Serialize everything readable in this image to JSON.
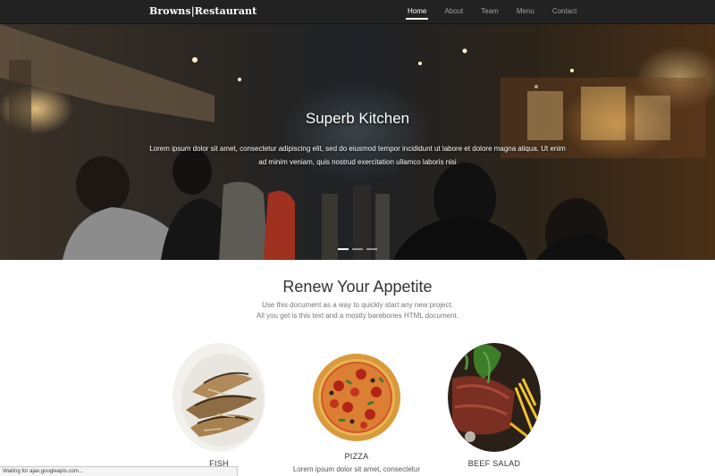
{
  "navbar": {
    "brand": "Browns|Restaurant",
    "items": [
      {
        "label": "Home",
        "active": true
      },
      {
        "label": "About",
        "active": false
      },
      {
        "label": "Team",
        "active": false
      },
      {
        "label": "Menu",
        "active": false
      },
      {
        "label": "Contact",
        "active": false
      }
    ]
  },
  "hero": {
    "title": "Superb Kitchen",
    "text": "Lorem ipsum dolor sit amet, consectetur adipiscing elit, sed do eiusmod tempor incididunt ut labore et dolore magna aliqua. Ut enim ad minim veniam, quis nostrud exercitation ullamco laboris nisi",
    "slides": 3,
    "active_slide": 0
  },
  "intro": {
    "title": "Renew Your Appetite",
    "line1": "Use this document as a way to quickly start any new project.",
    "line2": "All you get is this text and a mostly barebones HTML document."
  },
  "dishes": [
    {
      "name": "FISH",
      "description": "",
      "icon": "fried-fish-plate"
    },
    {
      "name": "PIZZA",
      "description": "Lorem ipsum dolor sit amet, consectetur",
      "icon": "pizza"
    },
    {
      "name": "BEEF SALAD",
      "description": "",
      "icon": "beef-salad"
    }
  ],
  "status_bar": {
    "text": "Waiting for ajax.googleapis.com..."
  },
  "colors": {
    "navbar_bg": "#222222",
    "nav_active": "#ffffff",
    "nav_inactive": "#9d9d9d",
    "heading": "#333333",
    "muted_text": "#777777"
  }
}
